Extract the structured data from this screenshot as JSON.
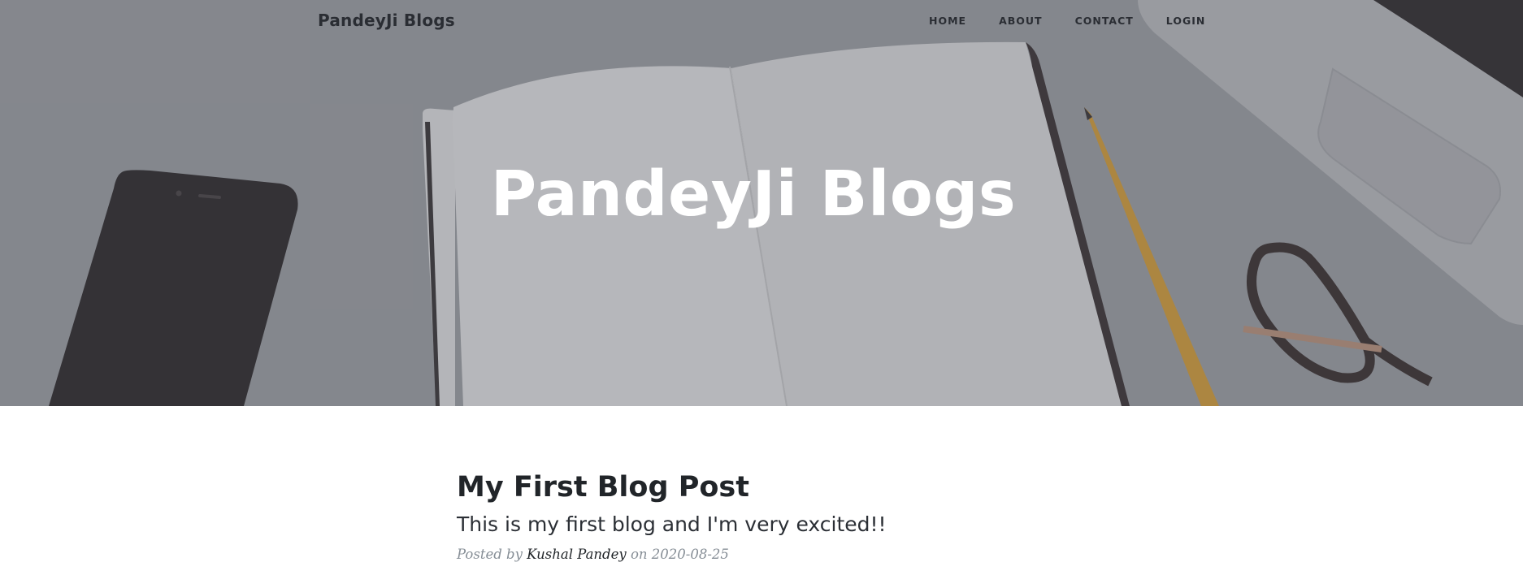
{
  "navbar": {
    "brand": "PandeyJi Blogs",
    "links": [
      {
        "label": "HOME"
      },
      {
        "label": "ABOUT"
      },
      {
        "label": "CONTACT"
      },
      {
        "label": "LOGIN"
      }
    ]
  },
  "hero": {
    "heading": "PandeyJi Blogs",
    "background_scene": "desk-with-notebook-phone-pencil-glasses-laptop"
  },
  "post": {
    "title": "My First Blog Post",
    "subtitle": "This is my first blog and I'm very excited!!",
    "meta_prefix": "Posted by ",
    "author": "Kushal Pandey",
    "meta_on": " on ",
    "date": "2020-08-25"
  },
  "colors": {
    "text_dark": "#212529",
    "text_muted": "#868e96",
    "hero_text": "#ffffff"
  }
}
